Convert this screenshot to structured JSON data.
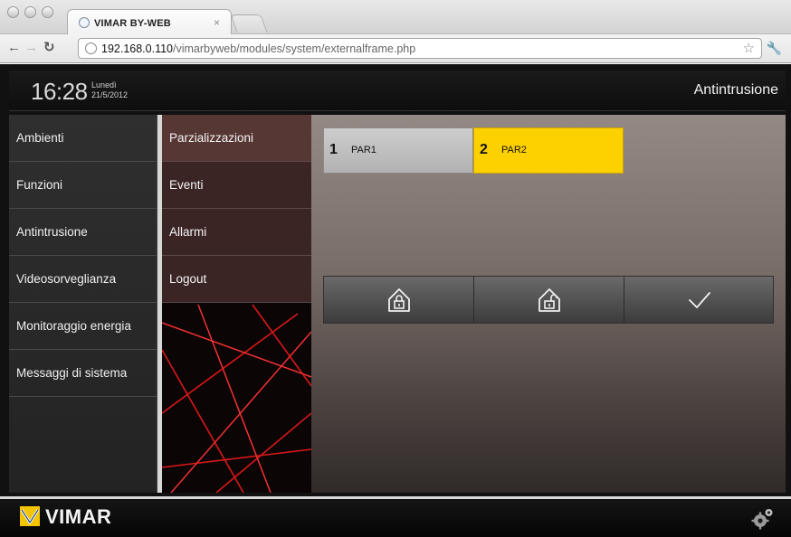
{
  "browser": {
    "tab_title": "VIMAR BY-WEB",
    "tab_close": "×",
    "url_host": "192.168.0.110",
    "url_path": "/vimarbyweb/modules/system/externalframe.php",
    "icons": [
      "back-arrow-icon",
      "forward-arrow-icon",
      "reload-icon",
      "globe-icon",
      "star-icon",
      "wrench-icon"
    ]
  },
  "header": {
    "time": "16:28",
    "day": "Lunedì",
    "date": "21/5/2012",
    "section_title": "Antintrusione"
  },
  "left_menu": [
    {
      "label": "Ambienti"
    },
    {
      "label": "Funzioni"
    },
    {
      "label": "Antintrusione"
    },
    {
      "label": "Videosorveglianza"
    },
    {
      "label": "Monitoraggio energia"
    },
    {
      "label": "Messaggi di sistema"
    }
  ],
  "sub_menu": [
    {
      "label": "Parzializzazioni",
      "active": true
    },
    {
      "label": "Eventi"
    },
    {
      "label": "Allarmi"
    },
    {
      "label": "Logout"
    }
  ],
  "partitions": [
    {
      "number": "1",
      "name": "PAR1",
      "selected": false
    },
    {
      "number": "2",
      "name": "PAR2",
      "selected": true,
      "color": "#fdd100"
    }
  ],
  "actions": [
    {
      "icon": "house-lock-closed-icon"
    },
    {
      "icon": "house-lock-open-icon"
    },
    {
      "icon": "checkmark-icon"
    }
  ],
  "footer": {
    "brand": "VIMAR",
    "settings_icon": "gears-icon"
  }
}
